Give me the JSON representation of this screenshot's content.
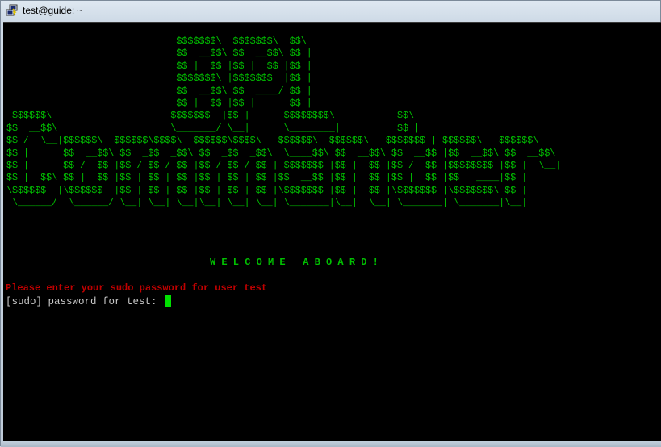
{
  "window": {
    "title": "test@guide: ~",
    "icon": "putty-terminal-icon"
  },
  "terminal": {
    "banner_lines": [
      "                              $$$$$$$\\  $$$$$$$\\  $$\\",
      "                              $$  __$$\\ $$  __$$\\ $$ |",
      "                              $$ |  $$ |$$ |  $$ |$$ |",
      "                              $$$$$$$\\ |$$$$$$$  |$$ |",
      "                              $$  __$$\\ $$  ____/ $$ |",
      "                              $$ |  $$ |$$ |      $$ |",
      " $$$$$$\\                     $$$$$$$  |$$ |      $$$$$$$$\\           $$\\",
      "$$  __$$\\                    \\_______/ \\__|      \\________|          $$ |",
      "$$ /  \\__|$$$$$$\\  $$$$$$\\$$$$\\  $$$$$$\\$$$$\\   $$$$$$\\  $$$$$$\\   $$$$$$$ | $$$$$$\\   $$$$$$\\",
      "$$ |      $$  __$$\\ $$  _$$  _$$\\ $$  _$$  _$$\\  \\____$$\\ $$  __$$\\ $$  __$$ |$$  __$$\\ $$  __$$\\",
      "$$ |      $$ /  $$ |$$ / $$ / $$ |$$ / $$ / $$ | $$$$$$$ |$$ |  $$ |$$ /  $$ |$$$$$$$$ |$$ |  \\__|",
      "$$ |  $$\\ $$ |  $$ |$$ | $$ | $$ |$$ | $$ | $$ |$$  __$$ |$$ |  $$ |$$ |  $$ |$$   ____|$$ |",
      "\\$$$$$$  |\\$$$$$$  |$$ | $$ | $$ |$$ | $$ | $$ |\\$$$$$$$ |$$ |  $$ |\\$$$$$$$ |\\$$$$$$$\\ $$ |",
      " \\______/  \\______/ \\__| \\__| \\__|\\__| \\__| \\__| \\_______|\\__|  \\__| \\_______| \\_______|\\__|"
    ],
    "welcome_message": "W E L C O M E   A B O A R D !",
    "warning_message": "Please enter your sudo password for user test",
    "prompt": "[sudo] password for test: "
  },
  "colors": {
    "banner": "#00c000",
    "warning": "#c00000",
    "prompt": "#c8c8c8",
    "cursor": "#00e000",
    "background": "#000000"
  }
}
